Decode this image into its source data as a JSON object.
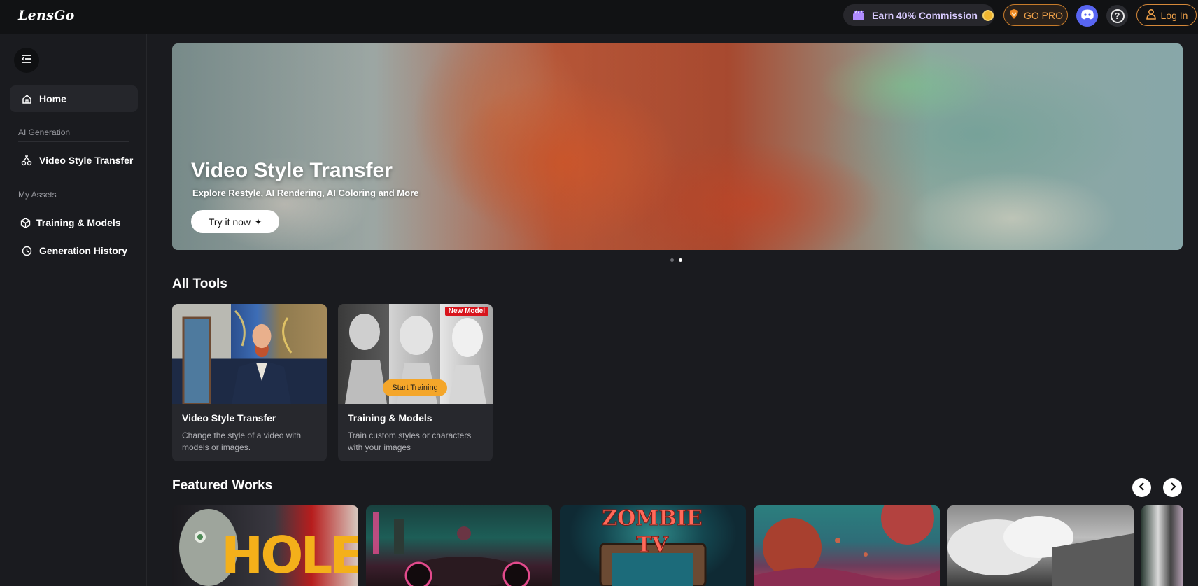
{
  "header": {
    "logo": "LensGo",
    "earn_label": "Earn 40% Commission",
    "gopro_label": "GO PRO",
    "login_label": "Log In"
  },
  "sidebar": {
    "home_label": "Home",
    "section_ai": "AI Generation",
    "video_style_label": "Video Style Transfer",
    "section_assets": "My Assets",
    "training_label": "Training & Models",
    "history_label": "Generation History"
  },
  "hero": {
    "title": "Video Style Transfer",
    "subtitle": "Explore Restyle, AI Rendering, AI Coloring and More",
    "cta": "Try it now",
    "slides_total": 2,
    "active_slide": 2
  },
  "tools": {
    "title": "All Tools",
    "items": [
      {
        "name": "Video Style Transfer",
        "desc": "Change the style of a video with models or images."
      },
      {
        "name": "Training & Models",
        "desc": "Train custom styles or characters with your images",
        "badge": "New Model",
        "hover_button": "Start Training"
      }
    ]
  },
  "featured": {
    "title": "Featured Works",
    "items": [
      {
        "text": "HOLE"
      },
      {
        "text": ""
      },
      {
        "text": "ZOMBIE TV"
      },
      {
        "text": ""
      },
      {
        "text": ""
      },
      {
        "text": ""
      }
    ]
  },
  "colors": {
    "accent_orange": "#f0a24a",
    "discord": "#5865f2",
    "badge_red": "#d8141c"
  }
}
